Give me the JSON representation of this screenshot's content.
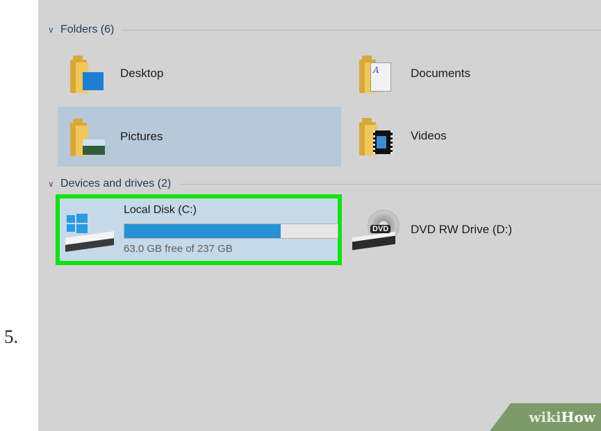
{
  "step_number": "5.",
  "folders_section": {
    "header": "Folders (6)"
  },
  "folders": [
    {
      "label": "Desktop",
      "icon": "desktop-folder-icon"
    },
    {
      "label": "Documents",
      "icon": "documents-folder-icon"
    },
    {
      "label": "Pictures",
      "icon": "pictures-folder-icon"
    },
    {
      "label": "Videos",
      "icon": "videos-folder-icon"
    }
  ],
  "devices_section": {
    "header": "Devices and drives (2)"
  },
  "drives": [
    {
      "label": "Local Disk (C:)",
      "free_text": "63.0 GB free of 237 GB",
      "used_fraction": 0.734
    },
    {
      "label": "DVD RW Drive (D:)",
      "icon_text": "DVD"
    }
  ],
  "colors": {
    "highlight_border": "#13e013",
    "progress_fill": "#2692d6",
    "selection": "#b7c8d8"
  },
  "watermark": {
    "part1": "wiki",
    "part2": "How"
  }
}
